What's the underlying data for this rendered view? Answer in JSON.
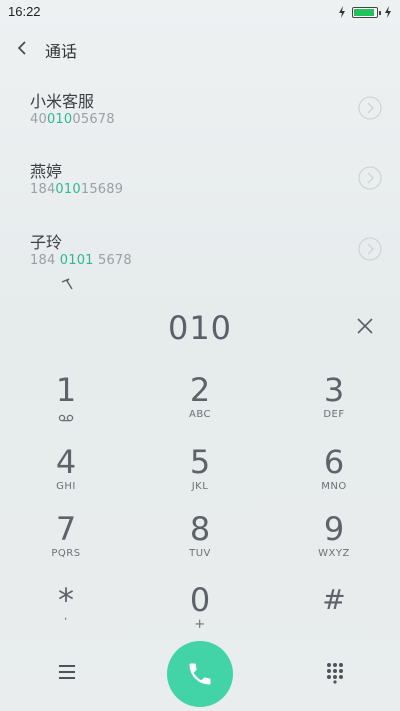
{
  "status": {
    "time": "16:22",
    "battery_level": 0.9,
    "battery_color": "#21c35a"
  },
  "nav": {
    "title": "通话",
    "back_icon": "chevron-left-icon"
  },
  "contacts": [
    {
      "name": "小米客服",
      "num_pre": "40",
      "num_hl": "010",
      "num_post": "05678"
    },
    {
      "name": "燕婷",
      "num_pre": "184",
      "num_hl": "010",
      "num_post": "15689"
    },
    {
      "name": "子玲",
      "num_pre": "184 ",
      "num_hl": "0101",
      "num_post": " 5678"
    }
  ],
  "dial": {
    "input": "010"
  },
  "keypad": [
    {
      "digit": "1",
      "letters": "",
      "icon": "voicemail-icon"
    },
    {
      "digit": "2",
      "letters": "ABC"
    },
    {
      "digit": "3",
      "letters": "DEF"
    },
    {
      "digit": "4",
      "letters": "GHI"
    },
    {
      "digit": "5",
      "letters": "JKL"
    },
    {
      "digit": "6",
      "letters": "MNO"
    },
    {
      "digit": "7",
      "letters": "PQRS"
    },
    {
      "digit": "8",
      "letters": "TUV"
    },
    {
      "digit": "9",
      "letters": "WXYZ"
    },
    {
      "digit": "*",
      "letters": ","
    },
    {
      "digit": "0",
      "letters": "+"
    },
    {
      "digit": "#",
      "letters": ""
    }
  ],
  "colors": {
    "accent": "#2fb894",
    "call_button": "#42d3a7"
  }
}
